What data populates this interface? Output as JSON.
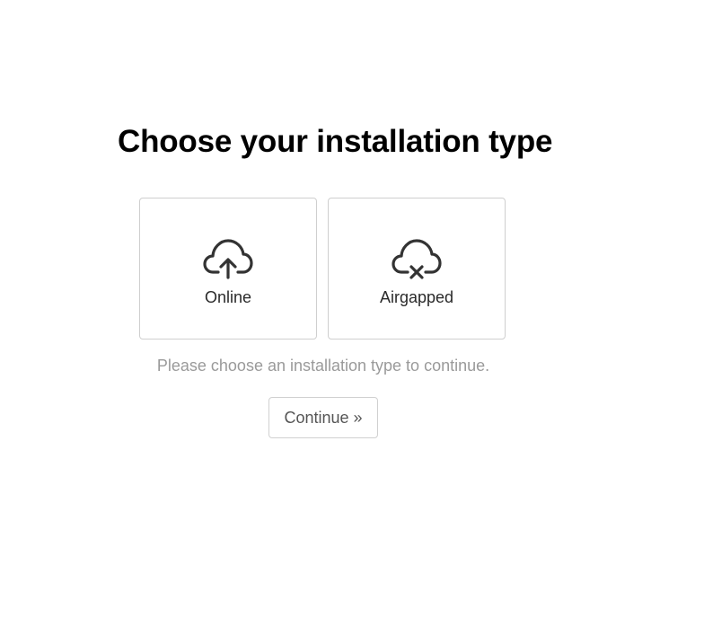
{
  "page": {
    "title": "Choose your installation type",
    "hint": "Please choose an installation type to continue.",
    "continue_label": "Continue »"
  },
  "options": [
    {
      "label": "Online",
      "icon": "cloud-upload-icon"
    },
    {
      "label": "Airgapped",
      "icon": "cloud-offline-icon"
    }
  ],
  "colors": {
    "text": "#000000",
    "card_border": "#cfcfcf",
    "icon": "#333333",
    "hint": "#9a9a9a",
    "button_text": "#555555"
  }
}
